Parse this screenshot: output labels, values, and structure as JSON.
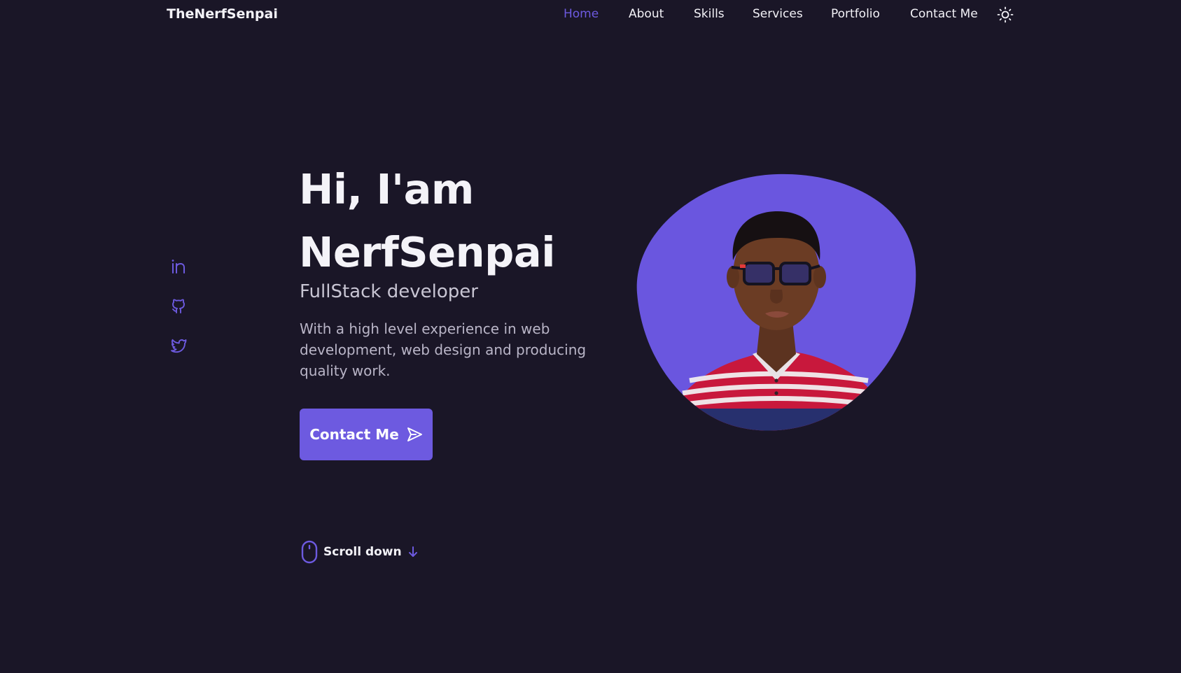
{
  "brand": {
    "name": "TheNerfSenpai"
  },
  "nav": {
    "items": [
      {
        "label": "Home",
        "active": true
      },
      {
        "label": "About",
        "active": false
      },
      {
        "label": "Skills",
        "active": false
      },
      {
        "label": "Services",
        "active": false
      },
      {
        "label": "Portfolio",
        "active": false
      },
      {
        "label": "Contact Me",
        "active": false
      }
    ],
    "theme_icon": "sun-icon"
  },
  "socials": [
    {
      "name": "linkedin",
      "icon": "linkedin-icon"
    },
    {
      "name": "github",
      "icon": "github-icon"
    },
    {
      "name": "twitter",
      "icon": "twitter-icon"
    }
  ],
  "hero": {
    "title_line1": "Hi, I'am",
    "title_line2": "NerfSenpai",
    "subtitle": "FullStack developer",
    "description": "With a high level experience in web development, web design and producing quality work.",
    "cta_label": "Contact Me",
    "cta_icon": "send-icon",
    "image_alt": "profile-photo"
  },
  "scroll": {
    "label": "Scroll down",
    "mouse_icon": "mouse-icon",
    "arrow_icon": "arrow-down-icon"
  },
  "colors": {
    "background": "#1a1627",
    "accent": "#6d5ae0",
    "text": "#f3f2f7",
    "muted": "#b9b5c7"
  }
}
